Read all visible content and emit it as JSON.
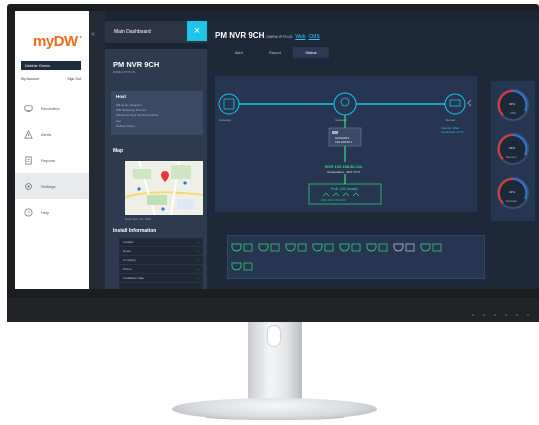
{
  "app": {
    "logo": "myDW",
    "user_name": "Debbie Green",
    "my_account": "My Account",
    "sign_out": "Sign Out",
    "menu_title": "Main Dashboard",
    "nav": [
      {
        "label": "Recorders",
        "icon": "recorder-icon"
      },
      {
        "label": "Alerts",
        "icon": "alert-icon"
      },
      {
        "label": "Reports",
        "icon": "report-icon"
      },
      {
        "label": "Settings",
        "icon": "settings-icon"
      },
      {
        "label": "Help",
        "icon": "help-icon"
      }
    ]
  },
  "device": {
    "name": "PM NVR 9CH",
    "model": "DWRAI IP PLUS",
    "host_heading": "Host",
    "host_lines": [
      "HB as an integrator",
      "D/B Marketing Director",
      "Marketing Dept Technical Writer",
      "test",
      "Debbie Green"
    ],
    "map_heading": "Map",
    "location": "New York, NY, USA",
    "install_heading": "Install Information",
    "install_rows": [
      "Installer",
      "Email",
      "Company",
      "Phone",
      "Installation date"
    ]
  },
  "header": {
    "title": "PM NVR 9CH",
    "model": "DWRAI IP PLUS",
    "link_web": "Web",
    "link_cms": "CMS",
    "tabs": [
      "Alert",
      "Report",
      "Status"
    ],
    "active_tab": "Status"
  },
  "topology": {
    "router_label": "Gateway",
    "switch_label": "Gateway",
    "nvr_label": "NVR 192.168.50.114",
    "nvr_temp": "Temperature : 46.0 °F/°C",
    "gateway_label": "GATEWAY",
    "gateway_ip": "192.168.50.1",
    "poe_label": "PoE (16.0watt)",
    "poe_ports": "Ch1 Ch2 Ch3 Ch4",
    "internet_label": "Internet",
    "internet_status_1": "Internet: ENA",
    "internet_status_2": "connected: 3-7%"
  },
  "gauges": [
    {
      "label": "CPU",
      "value": "30%",
      "level": 0.3
    },
    {
      "label": "Memory",
      "value": "23%",
      "level": 0.23
    },
    {
      "label": "Network",
      "value": "23%",
      "level": 0.23
    }
  ],
  "colors": {
    "accent": "#1cc6e8",
    "status_green": "#31e07a",
    "panel": "#2e3a4f",
    "logo": "#f26b1d"
  }
}
